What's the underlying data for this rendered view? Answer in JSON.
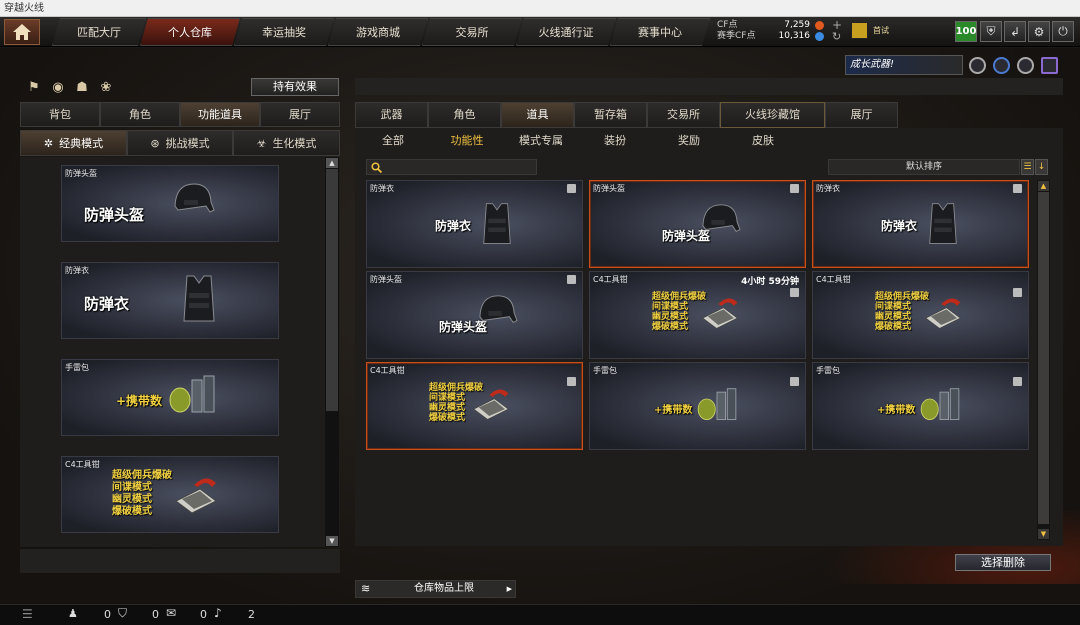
{
  "window": {
    "title": "穿越火线"
  },
  "nav": {
    "tabs": [
      {
        "label": "匹配大厅",
        "active": false
      },
      {
        "label": "个人仓库",
        "active": true
      },
      {
        "label": "幸运抽奖",
        "active": false
      },
      {
        "label": "游戏商城",
        "active": false
      },
      {
        "label": "交易所",
        "active": false
      },
      {
        "label": "火线通行证",
        "active": false
      },
      {
        "label": "赛事中心",
        "active": false
      }
    ]
  },
  "currency": {
    "cf_label": "CF点",
    "cf_value": "7,259",
    "season_label": "赛季CF点",
    "season_value": "10,316",
    "badge_text": "首试"
  },
  "toolbar": {
    "level": "100"
  },
  "banner": {
    "text": "成长武器!"
  },
  "left": {
    "effect_button": "持有效果",
    "tabs": [
      {
        "label": "背包",
        "active": false
      },
      {
        "label": "角色",
        "active": false
      },
      {
        "label": "功能道具",
        "active": true
      },
      {
        "label": "展厅",
        "active": false
      }
    ],
    "modes": [
      {
        "label": "经典模式",
        "active": true
      },
      {
        "label": "挑战模式",
        "active": false
      },
      {
        "label": "生化模式",
        "active": false
      }
    ],
    "items": [
      {
        "name": "防弹头盔",
        "label": "防弹头盔"
      },
      {
        "name": "防弹衣",
        "label": "防弹衣"
      },
      {
        "name": "手雷包",
        "label": "+携带数"
      },
      {
        "name": "C4工具钳",
        "lines": [
          "超级佣兵爆破",
          "间谍模式",
          "幽灵模式",
          "爆破模式"
        ]
      }
    ]
  },
  "right": {
    "tabs": [
      {
        "label": "武器",
        "active": false
      },
      {
        "label": "角色",
        "active": false
      },
      {
        "label": "道具",
        "active": true
      },
      {
        "label": "暂存箱",
        "active": false
      },
      {
        "label": "交易所",
        "active": false
      },
      {
        "label": "火线珍藏馆",
        "active": false
      },
      {
        "label": "展厅",
        "active": false
      }
    ],
    "subtabs": [
      {
        "label": "全部",
        "active": false
      },
      {
        "label": "功能性",
        "active": true
      },
      {
        "label": "模式专属",
        "active": false
      },
      {
        "label": "装扮",
        "active": false
      },
      {
        "label": "奖励",
        "active": false
      },
      {
        "label": "皮肤",
        "active": false
      }
    ],
    "sort_label": "默认排序",
    "cards": [
      {
        "name": "防弹衣",
        "label": "防弹衣",
        "highlight": false
      },
      {
        "name": "防弹头盔",
        "label": "防弹头盔",
        "highlight": true
      },
      {
        "name": "防弹衣",
        "label": "防弹衣",
        "highlight": true
      },
      {
        "name": "防弹头盔",
        "label": "防弹头盔",
        "highlight": false
      },
      {
        "name": "C4工具钳",
        "timer": "4小时 59分钟",
        "lines": [
          "超级佣兵爆破",
          "间谍模式",
          "幽灵模式",
          "爆破模式"
        ],
        "highlight": false
      },
      {
        "name": "C4工具钳",
        "lines": [
          "超级佣兵爆破",
          "间谍模式",
          "幽灵模式",
          "爆破模式"
        ],
        "highlight": false
      },
      {
        "name": "C4工具钳",
        "lines": [
          "超级佣兵爆破",
          "间谍模式",
          "幽灵模式",
          "爆破模式"
        ],
        "highlight": true
      },
      {
        "name": "手雷包",
        "label": "+携带数",
        "highlight": false
      },
      {
        "name": "手雷包",
        "label": "+携带数",
        "highlight": false
      }
    ],
    "delete_button": "选择删除",
    "capacity_label": "仓库物品上限"
  },
  "status": {
    "friends": "0",
    "clan": "0",
    "chat": "0",
    "volume": "2"
  }
}
